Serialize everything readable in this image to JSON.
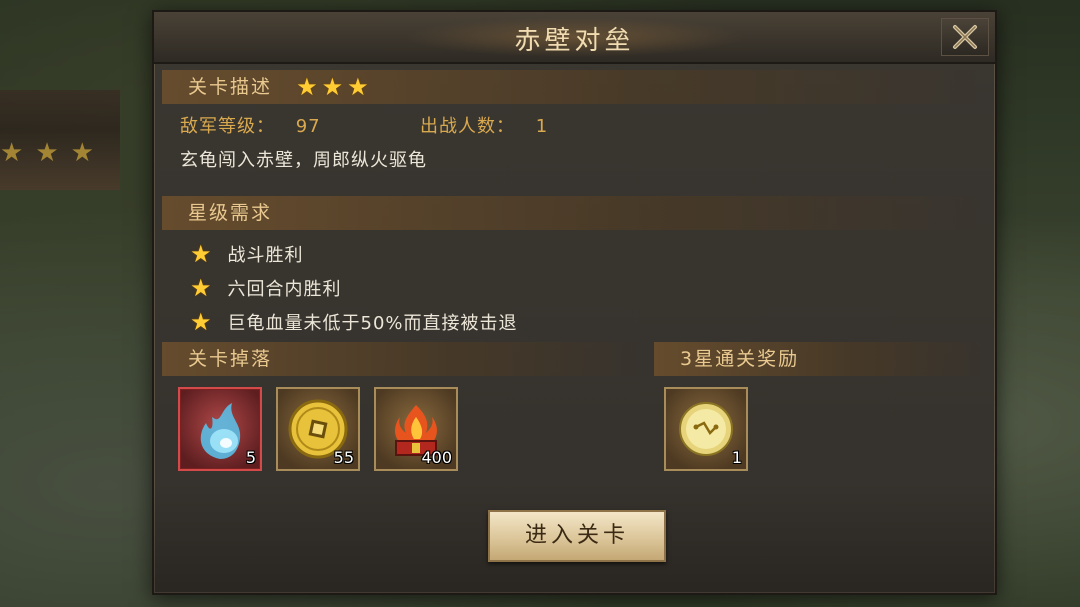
{
  "dialog": {
    "title": "赤壁对垒",
    "close_icon": "close-x-icon"
  },
  "level_description": {
    "header": "关卡描述",
    "stars": 3,
    "enemy_level_label": "敌军等级：",
    "enemy_level_value": "97",
    "troop_count_label": "出战人数：",
    "troop_count_value": "1",
    "description": "玄龟闯入赤壁，周郎纵火驱龟"
  },
  "star_requirements": {
    "header": "星级需求",
    "items": [
      {
        "icon": "star-icon",
        "text": "战斗胜利"
      },
      {
        "icon": "star-icon",
        "text": "六回合内胜利"
      },
      {
        "icon": "star-icon",
        "text": "巨龟血量未低于50%而直接被击退"
      }
    ]
  },
  "drops": {
    "header": "关卡掉落",
    "items": [
      {
        "icon": "blue-soul-flame-icon",
        "count": "5",
        "rarity": "red"
      },
      {
        "icon": "gold-coin-icon",
        "count": "55",
        "rarity": "normal"
      },
      {
        "icon": "fire-chest-icon",
        "count": "400",
        "rarity": "normal"
      }
    ]
  },
  "three_star_reward": {
    "header": "3星通关奖励",
    "items": [
      {
        "icon": "gold-orb-icon",
        "count": "1"
      }
    ]
  },
  "enter_button": {
    "label": "进入关卡"
  },
  "colors": {
    "gold_text": "#d9a94f",
    "header_text": "#e9c98f",
    "star": "#ffcc33",
    "panel_bg": "#35312c",
    "button_bg": "#dcc69a"
  }
}
